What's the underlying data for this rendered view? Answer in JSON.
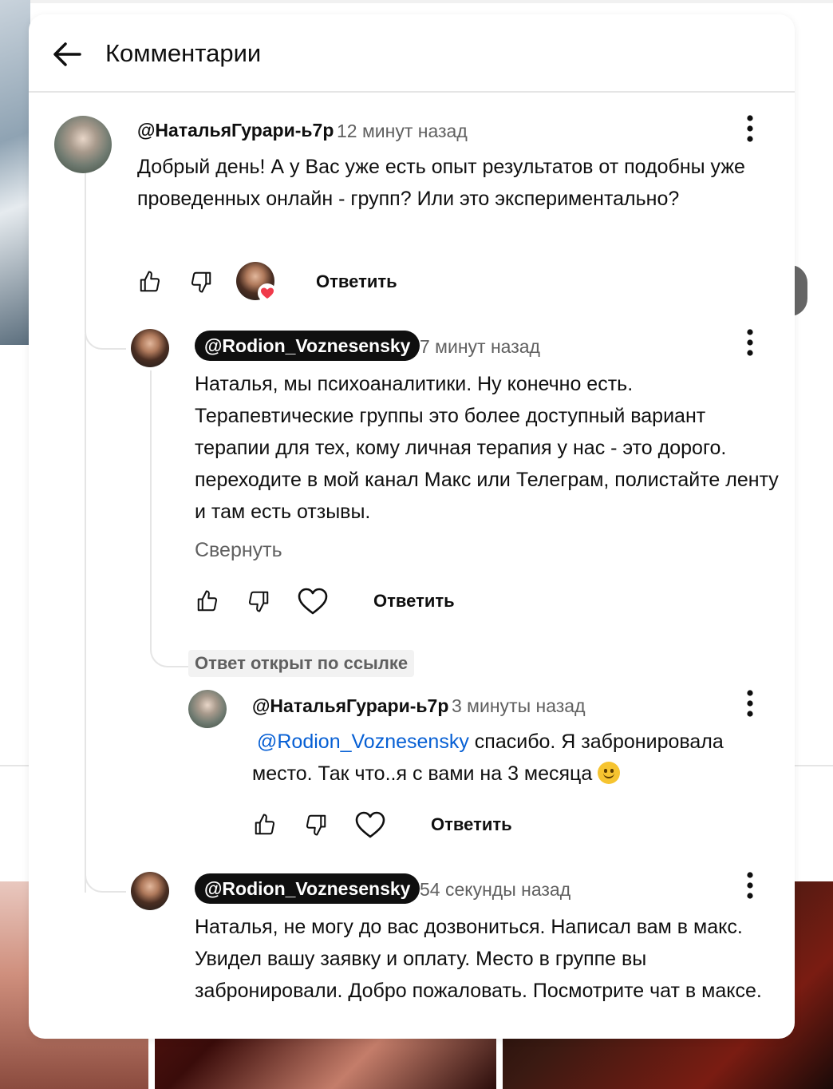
{
  "panel": {
    "title": "Комментарии"
  },
  "comments": [
    {
      "author": "@НатальяГурари-ь7р",
      "time": "12 минут назад",
      "text": "Добрый день! А у Вас уже есть опыт результатов от подобны уже проведенных онлайн - групп? Или это экспериментально?",
      "reply_label": "Ответить",
      "hearted_by_creator": true
    },
    {
      "author": "@Rodion_Voznesensky",
      "time": "7 минут назад",
      "text": "Наталья, мы психоаналитики. Ну конечно есть. Терапевтические группы это более доступный вариант терапии для тех, кому личная терапия у нас - это дорого. переходите в мой канал Макс или Телеграм, полистайте ленту и там есть отзывы.",
      "collapse_label": "Свернуть",
      "reply_label": "Ответить"
    },
    {
      "badge": "Ответ открыт по ссылке",
      "author": "@НатальяГурари-ь7р",
      "time": "3 минуты назад",
      "mention": "@Rodion_Voznesensky",
      "text": "спасибо. Я забронировала место. Так что..я с вами на 3 месяца",
      "emoji": "slightly-smiling-face",
      "reply_label": "Ответить"
    },
    {
      "author": "@Rodion_Voznesensky",
      "time": "54 секунды назад",
      "text": "Наталья, не могу до вас дозвониться. Написал вам в макс. Увидел вашу заявку и оплату. Место в группе вы забронировали. Добро пожаловать. Посмотрите чат в максе."
    }
  ]
}
